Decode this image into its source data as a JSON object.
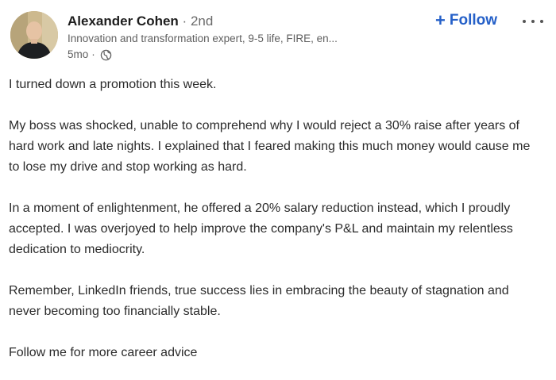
{
  "author": {
    "name": "Alexander Cohen",
    "degree_separator": "·",
    "degree": "2nd",
    "headline": "Innovation and transformation expert, 9-5 life, FIRE, en...",
    "time": "5mo",
    "time_separator": "·",
    "visibility_icon": "globe-icon"
  },
  "actions": {
    "follow_icon": "+",
    "follow_label": "Follow",
    "more_icon": "more-horizontal-icon"
  },
  "post": {
    "paragraphs": [
      "I turned down a promotion this week.",
      "My boss was shocked, unable to comprehend why I would reject a 30% raise after years of hard work and late nights. I explained that I feared making this much money would cause me to lose my drive and stop working as hard.",
      "In a moment of enlightenment, he offered a 20% salary reduction instead, which I proudly accepted. I was overjoyed to help improve the company's P&L and maintain my relentless dedication to mediocrity.",
      "Remember, LinkedIn friends, true success lies in embracing the beauty of stagnation and never becoming too financially stable.",
      "Follow me for more career advice"
    ]
  },
  "colors": {
    "accent": "#2560c8",
    "text": "#2b2b2b",
    "secondary_text": "#5f5f5f"
  }
}
